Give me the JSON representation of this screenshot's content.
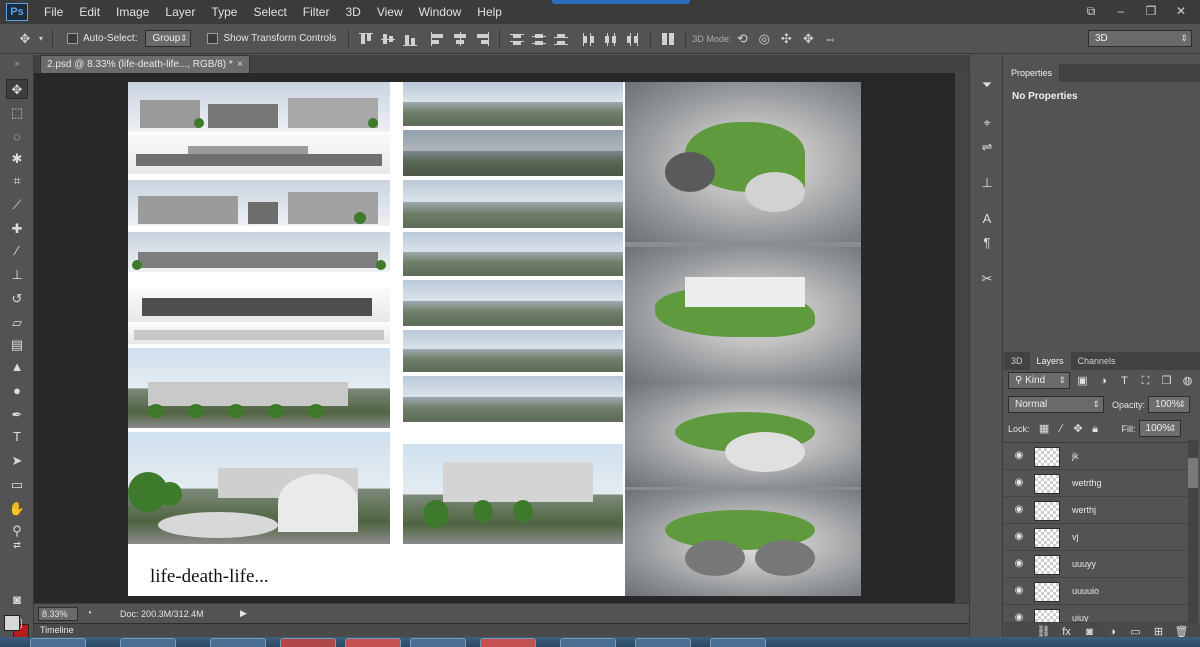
{
  "app": {
    "logo": "Ps"
  },
  "menu": [
    "File",
    "Edit",
    "Image",
    "Layer",
    "Type",
    "Select",
    "Filter",
    "3D",
    "View",
    "Window",
    "Help"
  ],
  "window_controls": [
    "⧉",
    "–",
    "❐",
    "✕"
  ],
  "options_bar": {
    "move_icon": "move-tool-icon",
    "auto_select_label": "Auto-Select:",
    "auto_select_value": "Group",
    "transform_label": "Show Transform Controls",
    "mode_3d_label": "3D Mode:",
    "workspace_value": "3D"
  },
  "document": {
    "tab_title": "2.psd @ 8.33% (life-death-life..., RGB/8) *",
    "close_symbol": "×",
    "caption": "life-death-life..."
  },
  "status": {
    "zoom": "8.33%",
    "doc_info": "Doc: 200.3M/312.4M"
  },
  "timeline_label": "Timeline",
  "properties": {
    "tab": "Properties",
    "message": "No Properties"
  },
  "layers_panel": {
    "tabs": [
      "3D",
      "Layers",
      "Channels"
    ],
    "filter_kind": "Kind",
    "blend_mode": "Normal",
    "opacity_label": "Opacity:",
    "opacity_value": "100%",
    "lock_label": "Lock:",
    "fill_label": "Fill:",
    "fill_value": "100%",
    "layers": [
      "jk",
      "wetrthg",
      "werthj",
      "vj",
      "uuuyy",
      "uuuuio",
      "uiuy"
    ]
  }
}
